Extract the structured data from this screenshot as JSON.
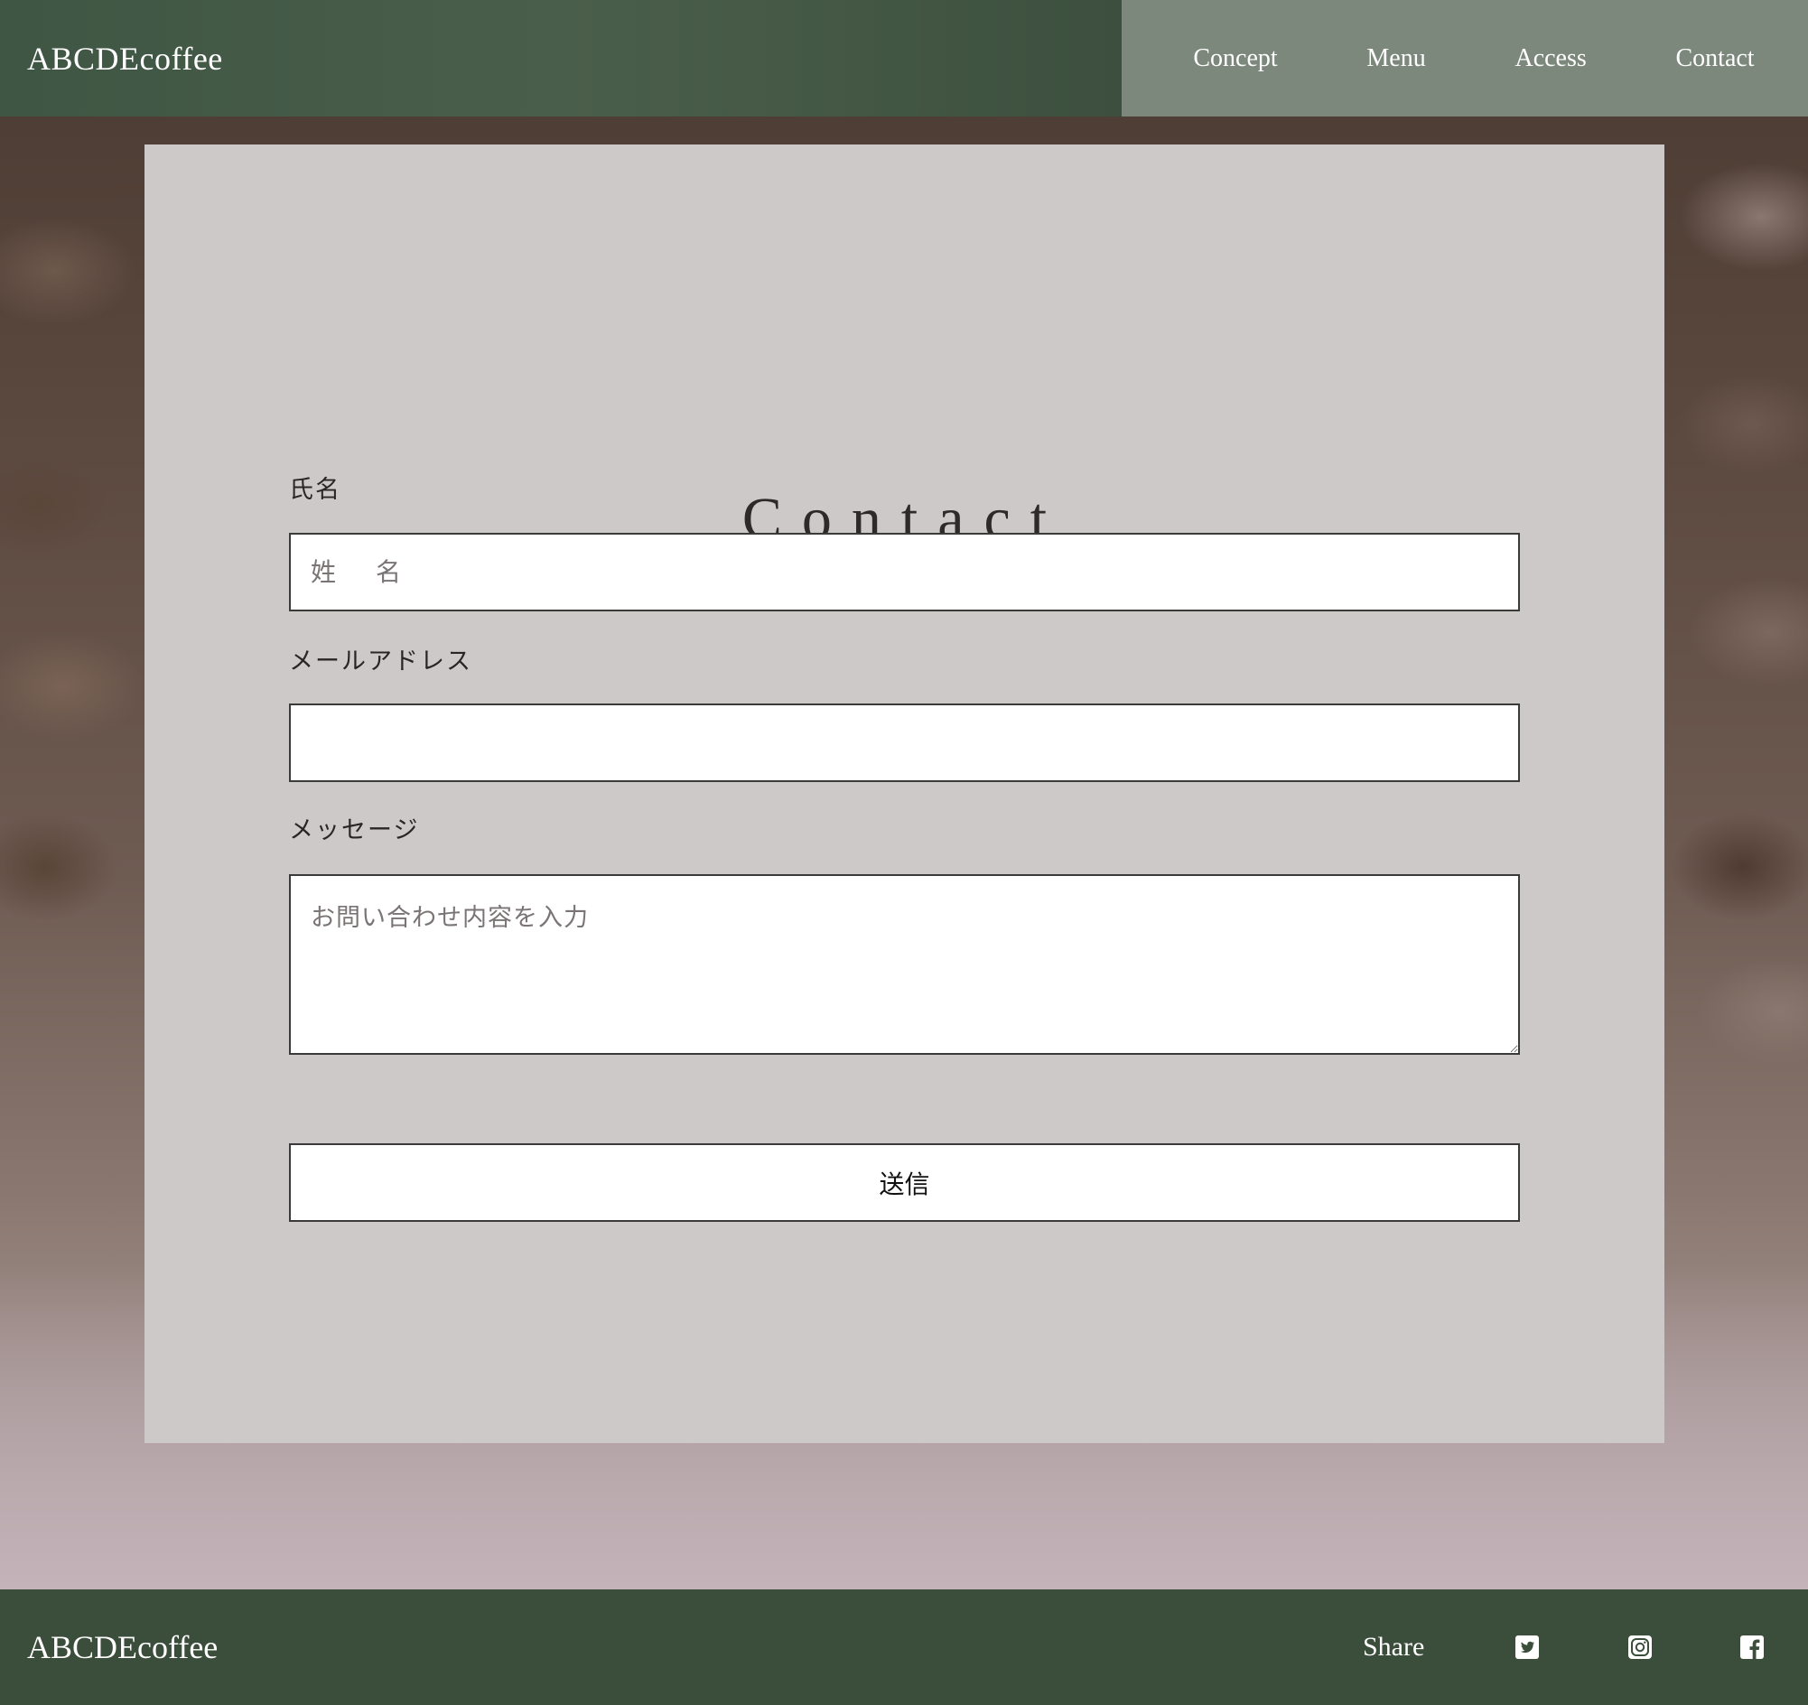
{
  "header": {
    "logo": "ABCDEcoffee",
    "nav": [
      {
        "label": "Concept"
      },
      {
        "label": "Menu"
      },
      {
        "label": "Access"
      },
      {
        "label": "Contact"
      }
    ]
  },
  "contact": {
    "title": "Contact",
    "name_label": "氏名",
    "name_placeholder": "姓　名",
    "email_label": "メールアドレス",
    "email_placeholder": "",
    "message_label": "メッセージ",
    "message_placeholder": "お問い合わせ内容を入力",
    "submit_label": "送信"
  },
  "footer": {
    "logo": "ABCDEcoffee",
    "share_label": "Share",
    "social_icons": [
      "twitter-icon",
      "instagram-icon",
      "facebook-icon"
    ]
  },
  "colors": {
    "header_green": "#3f5644",
    "nav_bg": "#7d887c",
    "panel_bg": "#cdc9c9",
    "footer_green": "#3b4d3b"
  }
}
